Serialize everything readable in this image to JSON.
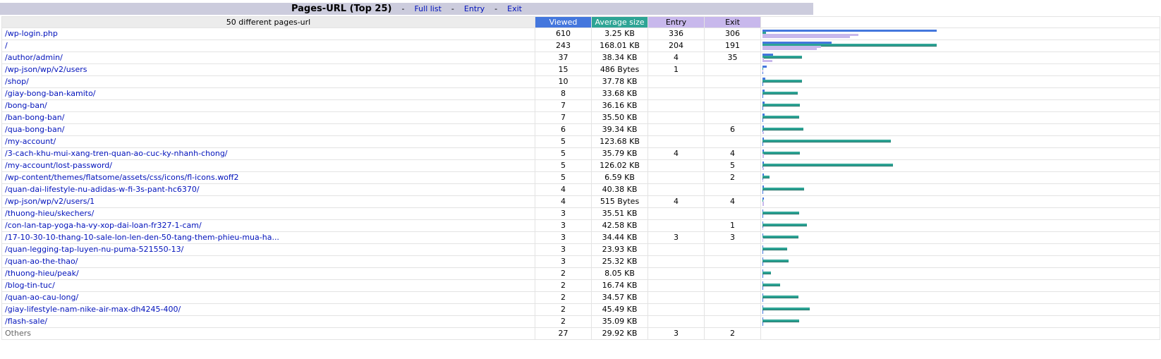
{
  "header": {
    "title": "Pages-URL (Top 25)",
    "links": [
      "Full list",
      "Entry",
      "Exit"
    ],
    "separator": "-"
  },
  "table": {
    "pages_label": "50 different pages-url",
    "columns": {
      "viewed": "Viewed",
      "avg": "Average size",
      "entry": "Entry",
      "exit": "Exit"
    },
    "colors": {
      "viewed": "#4477dd",
      "avg_size": "#2ea495",
      "entry": "#c8b8ec",
      "exit": "#c8b8ec"
    },
    "rows": [
      {
        "url": "/wp-login.php",
        "viewed": "610",
        "avg": "3.25 KB",
        "entry": "336",
        "exit": "306",
        "v": 610,
        "kb": 3.25,
        "en": 336,
        "ex": 306
      },
      {
        "url": "/",
        "viewed": "243",
        "avg": "168.01 KB",
        "entry": "204",
        "exit": "191",
        "v": 243,
        "kb": 168.01,
        "en": 204,
        "ex": 191
      },
      {
        "url": "/author/admin/",
        "viewed": "37",
        "avg": "38.34 KB",
        "entry": "4",
        "exit": "35",
        "v": 37,
        "kb": 38.34,
        "en": 4,
        "ex": 35
      },
      {
        "url": "/wp-json/wp/v2/users",
        "viewed": "15",
        "avg": "486 Bytes",
        "entry": "1",
        "exit": "",
        "v": 15,
        "kb": 0.47,
        "en": 1,
        "ex": 0
      },
      {
        "url": "/shop/",
        "viewed": "10",
        "avg": "37.78 KB",
        "entry": "",
        "exit": "",
        "v": 10,
        "kb": 37.78,
        "en": 0,
        "ex": 0
      },
      {
        "url": "/giay-bong-ban-kamito/",
        "viewed": "8",
        "avg": "33.68 KB",
        "entry": "",
        "exit": "",
        "v": 8,
        "kb": 33.68,
        "en": 0,
        "ex": 0
      },
      {
        "url": "/bong-ban/",
        "viewed": "7",
        "avg": "36.16 KB",
        "entry": "",
        "exit": "",
        "v": 7,
        "kb": 36.16,
        "en": 0,
        "ex": 0
      },
      {
        "url": "/ban-bong-ban/",
        "viewed": "7",
        "avg": "35.50 KB",
        "entry": "",
        "exit": "",
        "v": 7,
        "kb": 35.5,
        "en": 0,
        "ex": 0
      },
      {
        "url": "/qua-bong-ban/",
        "viewed": "6",
        "avg": "39.34 KB",
        "entry": "",
        "exit": "6",
        "v": 6,
        "kb": 39.34,
        "en": 0,
        "ex": 6
      },
      {
        "url": "/my-account/",
        "viewed": "5",
        "avg": "123.68 KB",
        "entry": "",
        "exit": "",
        "v": 5,
        "kb": 123.68,
        "en": 0,
        "ex": 0
      },
      {
        "url": "/3-cach-khu-mui-xang-tren-quan-ao-cuc-ky-nhanh-chong/",
        "viewed": "5",
        "avg": "35.79 KB",
        "entry": "4",
        "exit": "4",
        "v": 5,
        "kb": 35.79,
        "en": 4,
        "ex": 4
      },
      {
        "url": "/my-account/lost-password/",
        "viewed": "5",
        "avg": "126.02 KB",
        "entry": "",
        "exit": "5",
        "v": 5,
        "kb": 126.02,
        "en": 0,
        "ex": 5
      },
      {
        "url": "/wp-content/themes/flatsome/assets/css/icons/fl-icons.woff2",
        "viewed": "5",
        "avg": "6.59 KB",
        "entry": "",
        "exit": "2",
        "v": 5,
        "kb": 6.59,
        "en": 0,
        "ex": 2
      },
      {
        "url": "/quan-dai-lifestyle-nu-adidas-w-fi-3s-pant-hc6370/",
        "viewed": "4",
        "avg": "40.38 KB",
        "entry": "",
        "exit": "",
        "v": 4,
        "kb": 40.38,
        "en": 0,
        "ex": 0
      },
      {
        "url": "/wp-json/wp/v2/users/1",
        "viewed": "4",
        "avg": "515 Bytes",
        "entry": "4",
        "exit": "4",
        "v": 4,
        "kb": 0.5,
        "en": 4,
        "ex": 4
      },
      {
        "url": "/thuong-hieu/skechers/",
        "viewed": "3",
        "avg": "35.51 KB",
        "entry": "",
        "exit": "",
        "v": 3,
        "kb": 35.51,
        "en": 0,
        "ex": 0
      },
      {
        "url": "/con-lan-tap-yoga-ha-vy-xop-dai-loan-fr327-1-cam/",
        "viewed": "3",
        "avg": "42.58 KB",
        "entry": "",
        "exit": "1",
        "v": 3,
        "kb": 42.58,
        "en": 0,
        "ex": 1
      },
      {
        "url": "/17-10-30-10-thang-10-sale-lon-len-den-50-tang-them-phieu-mua-ha...",
        "viewed": "3",
        "avg": "34.44 KB",
        "entry": "3",
        "exit": "3",
        "v": 3,
        "kb": 34.44,
        "en": 3,
        "ex": 3
      },
      {
        "url": "/quan-legging-tap-luyen-nu-puma-521550-13/",
        "viewed": "3",
        "avg": "23.93 KB",
        "entry": "",
        "exit": "",
        "v": 3,
        "kb": 23.93,
        "en": 0,
        "ex": 0
      },
      {
        "url": "/quan-ao-the-thao/",
        "viewed": "3",
        "avg": "25.32 KB",
        "entry": "",
        "exit": "",
        "v": 3,
        "kb": 25.32,
        "en": 0,
        "ex": 0
      },
      {
        "url": "/thuong-hieu/peak/",
        "viewed": "2",
        "avg": "8.05 KB",
        "entry": "",
        "exit": "",
        "v": 2,
        "kb": 8.05,
        "en": 0,
        "ex": 0
      },
      {
        "url": "/blog-tin-tuc/",
        "viewed": "2",
        "avg": "16.74 KB",
        "entry": "",
        "exit": "",
        "v": 2,
        "kb": 16.74,
        "en": 0,
        "ex": 0
      },
      {
        "url": "/quan-ao-cau-long/",
        "viewed": "2",
        "avg": "34.57 KB",
        "entry": "",
        "exit": "",
        "v": 2,
        "kb": 34.57,
        "en": 0,
        "ex": 0
      },
      {
        "url": "/giay-lifestyle-nam-nike-air-max-dh4245-400/",
        "viewed": "2",
        "avg": "45.49 KB",
        "entry": "",
        "exit": "",
        "v": 2,
        "kb": 45.49,
        "en": 0,
        "ex": 0
      },
      {
        "url": "/flash-sale/",
        "viewed": "2",
        "avg": "35.09 KB",
        "entry": "",
        "exit": "",
        "v": 2,
        "kb": 35.09,
        "en": 0,
        "ex": 0
      }
    ],
    "others": {
      "label": "Others",
      "viewed": "27",
      "avg": "29.92 KB",
      "entry": "3",
      "exit": "2"
    }
  }
}
